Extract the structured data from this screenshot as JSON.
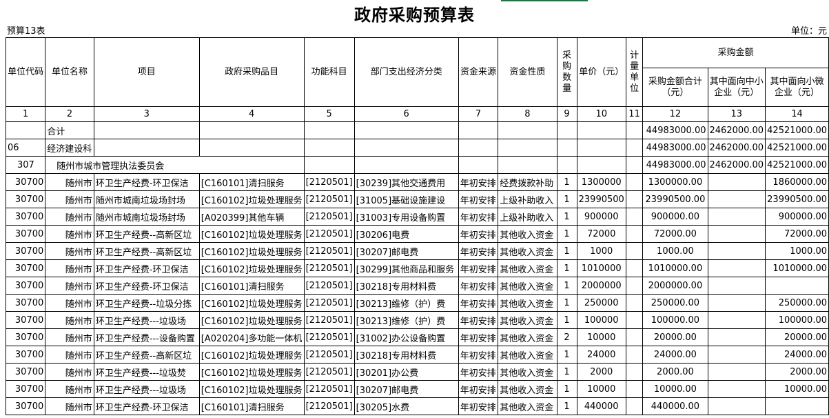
{
  "title": "政府采购预算表",
  "form_no": "预算13表",
  "unit": "单位：元",
  "headers": {
    "c1": "单位代码",
    "c2": "单位名称",
    "c3": "项目",
    "c4": "政府采购品目",
    "c5": "功能科目",
    "c6": "部门支出经济分类",
    "c7": "资金来源",
    "c8": "资金性质",
    "c9": "采购数量",
    "c10": "单价（元）",
    "c11": "计量单位",
    "group": "采购金额",
    "c12": "采购金额合计（元）",
    "c13": "其中面向中小企业（元）",
    "c14": "其中面向小微企业（元）"
  },
  "col_numbers": [
    "1",
    "2",
    "3",
    "4",
    "5",
    "6",
    "7",
    "8",
    "9",
    "10",
    "11",
    "12",
    "13",
    "14"
  ],
  "summary_rows": [
    {
      "code": "",
      "name": "合计",
      "total": "44983000.00",
      "sme": "2462000.00",
      "micro": "42521000.00"
    },
    {
      "code": "06",
      "name": "经济建设科",
      "total": "44983000.00",
      "sme": "2462000.00",
      "micro": "42521000.00"
    },
    {
      "code": "307",
      "name": "随州市城市管理执法委员会",
      "total": "44983000.00",
      "sme": "2462000.00",
      "micro": "42521000.00"
    }
  ],
  "rows": [
    {
      "code": "30700",
      "name": "随州市",
      "project": "环卫生产经费-环卫保洁",
      "item": "[C160101]清扫服务",
      "func": "[2120501]",
      "econ": "[30239]其他交通费用",
      "src": "年初安排",
      "nature": "经费拨款补助",
      "qty": "1",
      "price": "1300000",
      "unit": "",
      "total": "1300000.00",
      "sme": "",
      "micro": "1860000.00"
    },
    {
      "code": "30700",
      "name": "随州市",
      "project": "随州市城南垃圾场封场",
      "item": "[C160102]垃圾处理服务",
      "func": "[2120501]",
      "econ": "[31005]基础设施建设",
      "src": "年初安排",
      "nature": "上级补助收入",
      "qty": "1",
      "price": "23990500",
      "unit": "",
      "total": "23990500.00",
      "sme": "",
      "micro": "23990500.00"
    },
    {
      "code": "30700",
      "name": "随州市",
      "project": "随州市城南垃圾场封场",
      "item": "[A020399]其他车辆",
      "func": "[2120501]",
      "econ": "[31003]专用设备购置",
      "src": "年初安排",
      "nature": "上级补助收入",
      "qty": "1",
      "price": "900000",
      "unit": "",
      "total": "900000.00",
      "sme": "",
      "micro": "900000.00"
    },
    {
      "code": "30700",
      "name": "随州市",
      "project": "环卫生产经费--高新区垃",
      "item": "[C160102]垃圾处理服务",
      "func": "[2120501]",
      "econ": "[30206]电费",
      "src": "年初安排",
      "nature": "其他收入资金",
      "qty": "1",
      "price": "72000",
      "unit": "",
      "total": "72000.00",
      "sme": "",
      "micro": "72000.00"
    },
    {
      "code": "30700",
      "name": "随州市",
      "project": "环卫生产经费--高新区垃",
      "item": "[C160102]垃圾处理服务",
      "func": "[2120501]",
      "econ": "[30207]邮电费",
      "src": "年初安排",
      "nature": "其他收入资金",
      "qty": "1",
      "price": "1000",
      "unit": "",
      "total": "1000.00",
      "sme": "",
      "micro": "1000.00"
    },
    {
      "code": "30700",
      "name": "随州市",
      "project": "环卫生产经费-环卫保洁",
      "item": "[C160102]垃圾处理服务",
      "func": "[2120501]",
      "econ": "[30299]其他商品和服务",
      "src": "年初安排",
      "nature": "其他收入资金",
      "qty": "1",
      "price": "1010000",
      "unit": "",
      "total": "1010000.00",
      "sme": "",
      "micro": "1010000.00"
    },
    {
      "code": "30700",
      "name": "随州市",
      "project": "环卫生产经费-环卫保洁",
      "item": "[C160101]清扫服务",
      "func": "[2120501]",
      "econ": "[30218]专用材料费",
      "src": "年初安排",
      "nature": "其他收入资金",
      "qty": "1",
      "price": "2000000",
      "unit": "",
      "total": "2000000.00",
      "sme": "",
      "micro": ""
    },
    {
      "code": "30700",
      "name": "随州市",
      "project": "环卫生产经费--垃圾分拣",
      "item": "[C160102]垃圾处理服务",
      "func": "[2120501]",
      "econ": "[30213]维修（护）费",
      "src": "年初安排",
      "nature": "其他收入资金",
      "qty": "1",
      "price": "250000",
      "unit": "",
      "total": "250000.00",
      "sme": "",
      "micro": "250000.00"
    },
    {
      "code": "30700",
      "name": "随州市",
      "project": "环卫生产经费---垃圾场",
      "item": "[C160102]垃圾处理服务",
      "func": "[2120501]",
      "econ": "[30213]维修（护）费",
      "src": "年初安排",
      "nature": "其他收入资金",
      "qty": "1",
      "price": "100000",
      "unit": "",
      "total": "100000.00",
      "sme": "",
      "micro": "100000.00"
    },
    {
      "code": "30700",
      "name": "随州市",
      "project": "环卫生产经费---设备购置",
      "item": "[A020204]多功能一体机",
      "func": "[2120501]",
      "econ": "[31002]办公设备购置",
      "src": "年初安排",
      "nature": "其他收入资金",
      "qty": "2",
      "price": "10000",
      "unit": "",
      "total": "20000.00",
      "sme": "",
      "micro": "20000.00"
    },
    {
      "code": "30700",
      "name": "随州市",
      "project": "环卫生产经费--高新区垃",
      "item": "[C160102]垃圾处理服务",
      "func": "[2120501]",
      "econ": "[30218]专用材料费",
      "src": "年初安排",
      "nature": "其他收入资金",
      "qty": "1",
      "price": "24000",
      "unit": "",
      "total": "24000.00",
      "sme": "",
      "micro": "24000.00"
    },
    {
      "code": "30700",
      "name": "随州市",
      "project": "环卫生产经费---垃圾焚",
      "item": "[C160102]垃圾处理服务",
      "func": "[2120501]",
      "econ": "[30201]办公费",
      "src": "年初安排",
      "nature": "其他收入资金",
      "qty": "1",
      "price": "2000",
      "unit": "",
      "total": "2000.00",
      "sme": "",
      "micro": "2000.00"
    },
    {
      "code": "30700",
      "name": "随州市",
      "project": "环卫生产经费---垃圾场",
      "item": "[C160102]垃圾处理服务",
      "func": "[2120501]",
      "econ": "[30207]邮电费",
      "src": "年初安排",
      "nature": "其他收入资金",
      "qty": "1",
      "price": "10000",
      "unit": "",
      "total": "10000.00",
      "sme": "",
      "micro": "10000.00"
    },
    {
      "code": "30700",
      "name": "随州市",
      "project": "环卫生产经费-环卫保洁",
      "item": "[C160101]清扫服务",
      "func": "[2120501]",
      "econ": "[30205]水费",
      "src": "年初安排",
      "nature": "其他收入资金",
      "qty": "1",
      "price": "440000",
      "unit": "",
      "total": "440000.00",
      "sme": "",
      "micro": ""
    }
  ]
}
